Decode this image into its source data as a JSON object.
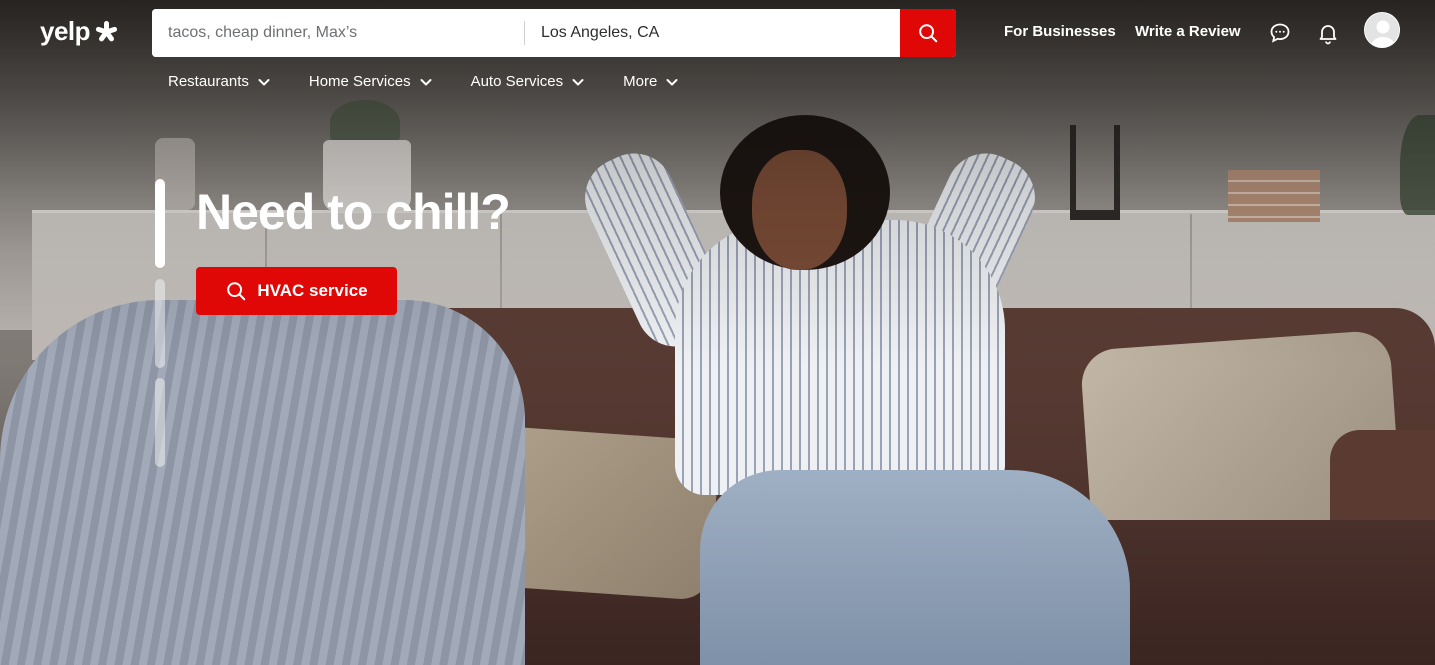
{
  "brand": {
    "logo_text": "yelp",
    "logo_icon": "yelp-burst-icon",
    "accent_color": "#e00707"
  },
  "search": {
    "find_placeholder": "tacos, cheap dinner, Max’s",
    "near_value": "Los Angeles, CA",
    "button_icon": "search-icon"
  },
  "header": {
    "for_businesses": "For Businesses",
    "write_review": "Write a Review",
    "messages_icon": "chat-bubble-icon",
    "notifications_icon": "bell-icon",
    "avatar_icon": "user-avatar-icon"
  },
  "categories": [
    {
      "label": "Restaurants",
      "icon": "chevron-down-icon"
    },
    {
      "label": "Home Services",
      "icon": "chevron-down-icon"
    },
    {
      "label": "Auto Services",
      "icon": "chevron-down-icon"
    },
    {
      "label": "More",
      "icon": "chevron-down-icon"
    }
  ],
  "hero": {
    "headline": "Need to chill?",
    "cta_label": "HVAC service",
    "cta_icon": "search-icon",
    "slides": 3,
    "active_slide": 1
  }
}
